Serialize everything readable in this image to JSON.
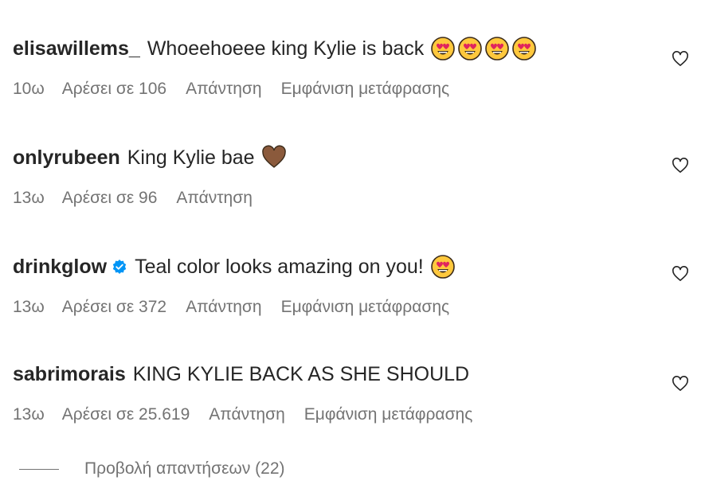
{
  "comments": [
    {
      "username": "elisawillems_",
      "text": "Whoeehoeee king Kylie is back",
      "verified": false,
      "emojis": [
        "heart-eyes-emoji",
        "heart-eyes-emoji",
        "heart-eyes-emoji",
        "heart-eyes-emoji"
      ],
      "time": "10ω",
      "likes": "Αρέσει σε 106",
      "reply": "Απάντηση",
      "translate": "Εμφάνιση μετάφρασης"
    },
    {
      "username": "onlyrubeen",
      "text": "King Kylie bae",
      "verified": false,
      "emojis": [
        "brown-heart-emoji"
      ],
      "time": "13ω",
      "likes": "Αρέσει σε 96",
      "reply": "Απάντηση",
      "translate": ""
    },
    {
      "username": "drinkglow",
      "text": "Teal color looks amazing on you!",
      "verified": true,
      "emojis": [
        "heart-eyes-emoji"
      ],
      "time": "13ω",
      "likes": "Αρέσει σε 372",
      "reply": "Απάντηση",
      "translate": "Εμφάνιση μετάφρασης"
    },
    {
      "username": "sabrimorais",
      "text": "KING KYLIE BACK AS SHE SHOULD",
      "verified": false,
      "emojis": [],
      "time": "13ω",
      "likes": "Αρέσει σε 25.619",
      "reply": "Απάντηση",
      "translate": "Εμφάνιση μετάφρασης"
    }
  ],
  "view_replies": "Προβολή απαντήσεων (22)",
  "colors": {
    "text_primary": "#262626",
    "text_secondary": "#737373",
    "verified_blue": "#0095f6",
    "emoji_yellow": "#ffc83d",
    "emoji_red": "#e0245e",
    "brown_heart": "#8b5a3c"
  }
}
